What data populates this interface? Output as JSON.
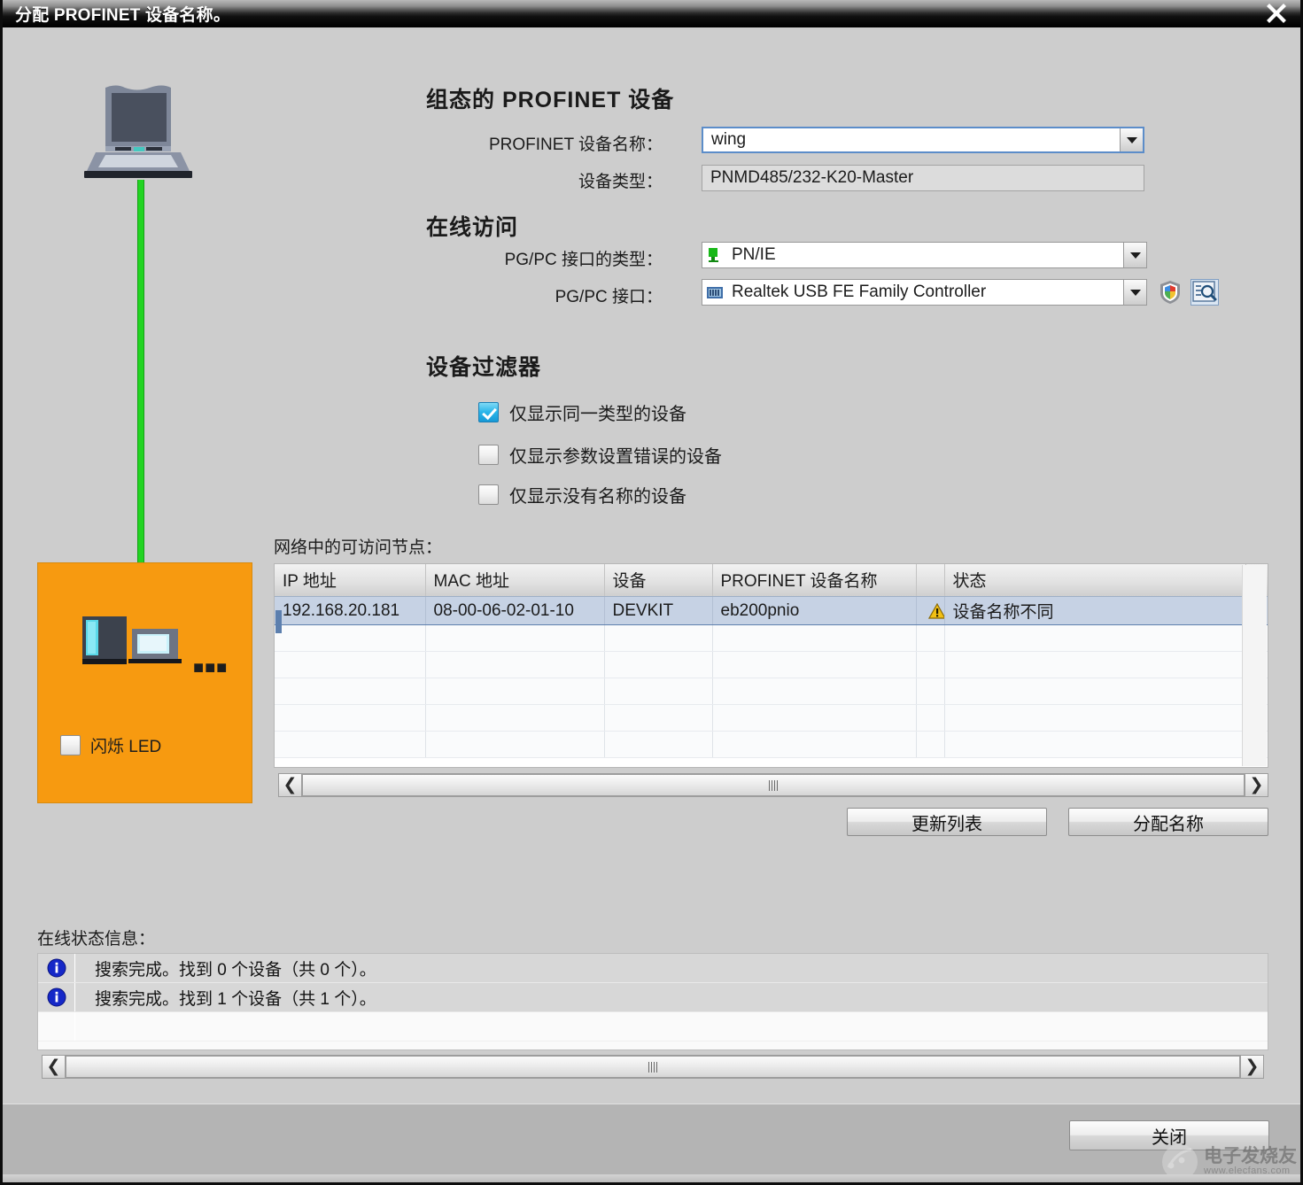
{
  "window": {
    "title": "分配 PROFINET 设备名称。",
    "close_icon": "close-icon"
  },
  "configured_device": {
    "heading": "组态的 PROFINET 设备",
    "name_label": "PROFINET 设备名称：",
    "name_value": "wing",
    "type_label": "设备类型：",
    "type_value": "PNMD485/232-K20-Master"
  },
  "online_access": {
    "heading": "在线访问",
    "interface_type_label": "PG/PC 接口的类型：",
    "interface_type_value": "PN/IE",
    "interface_label": "PG/PC 接口：",
    "interface_value": "Realtek USB FE Family Controller",
    "shield_icon": "shield-icon",
    "inspect_icon": "properties-search-icon"
  },
  "device_filter": {
    "heading": "设备过滤器",
    "items": [
      {
        "label": "仅显示同一类型的设备",
        "checked": true
      },
      {
        "label": "仅显示参数设置错误的设备",
        "checked": false
      },
      {
        "label": "仅显示没有名称的设备",
        "checked": false
      }
    ]
  },
  "device_panel": {
    "flash_led_label": "闪烁 LED",
    "flash_led_checked": false,
    "panel_color": "#f79a10",
    "cable_color": "#22d422"
  },
  "nodes_table": {
    "caption": "网络中的可访问节点：",
    "columns": [
      "IP 地址",
      "MAC 地址",
      "设备",
      "PROFINET 设备名称",
      "",
      "状态"
    ],
    "rows": [
      {
        "ip": "192.168.20.181",
        "mac": "08-00-06-02-01-10",
        "device": "DEVKIT",
        "profinet_name": "eb200pnio",
        "status_icon": "warning-icon",
        "status": "设备名称不同",
        "selected": true
      }
    ],
    "empty_row_count": 5,
    "scroll_left_icon": "chevron-left-icon",
    "scroll_right_icon": "chevron-right-icon"
  },
  "actions": {
    "update_list": "更新列表",
    "assign_name": "分配名称",
    "close": "关闭"
  },
  "status_info": {
    "caption": "在线状态信息：",
    "messages": [
      {
        "icon": "info-icon",
        "text": "搜索完成。找到 0 个设备（共 0 个）。"
      },
      {
        "icon": "info-icon",
        "text": "搜索完成。找到 1 个设备（共 1 个）。"
      }
    ],
    "scroll_left_icon": "chevron-left-icon",
    "scroll_right_icon": "chevron-right-icon"
  },
  "watermark": {
    "main": "电子发烧友",
    "sub": "www.elecfans.com"
  }
}
